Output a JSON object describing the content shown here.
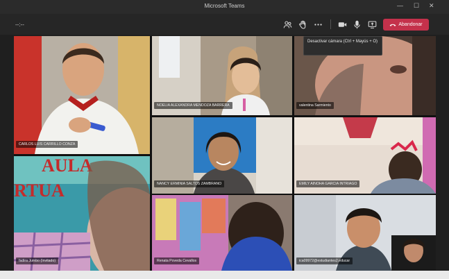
{
  "window": {
    "title": "Microsoft Teams",
    "minimize_glyph": "—",
    "maximize_glyph": "☐",
    "close_glyph": "✕"
  },
  "toolbar": {
    "timer": "--:--",
    "leave_label": "Abandonar",
    "icons": [
      "participants-icon",
      "raise-hand-icon",
      "more-options-icon",
      "camera-icon",
      "microphone-icon",
      "share-screen-icon",
      "phone-hangup-icon"
    ],
    "leave_color": "#c4314b"
  },
  "tooltip": {
    "text": "Desactivar cámara (Ctrl + Mayús + O)"
  },
  "participants": [
    {
      "name": "CARLOS LUIS CARRILLO CONZA"
    },
    {
      "name": "NOELIA ALEXANDRA MENDOZA BARRERA"
    },
    {
      "name": "valentina Sarmiento"
    },
    {
      "name": "NANCY ERMINIA SALTOS ZAMBRANO"
    },
    {
      "name": "EMILY AINOHA GARCIA INTRIAGO"
    },
    {
      "name": "fadira Jumbo (Invitado)"
    },
    {
      "name": "Renata Poveda Cevallos"
    },
    {
      "name": "ica09972@estudiantes2.educar"
    }
  ],
  "backgrounds": {
    "tile_aula_text_1": "AULA",
    "tile_aula_text_2": "RTUA"
  }
}
